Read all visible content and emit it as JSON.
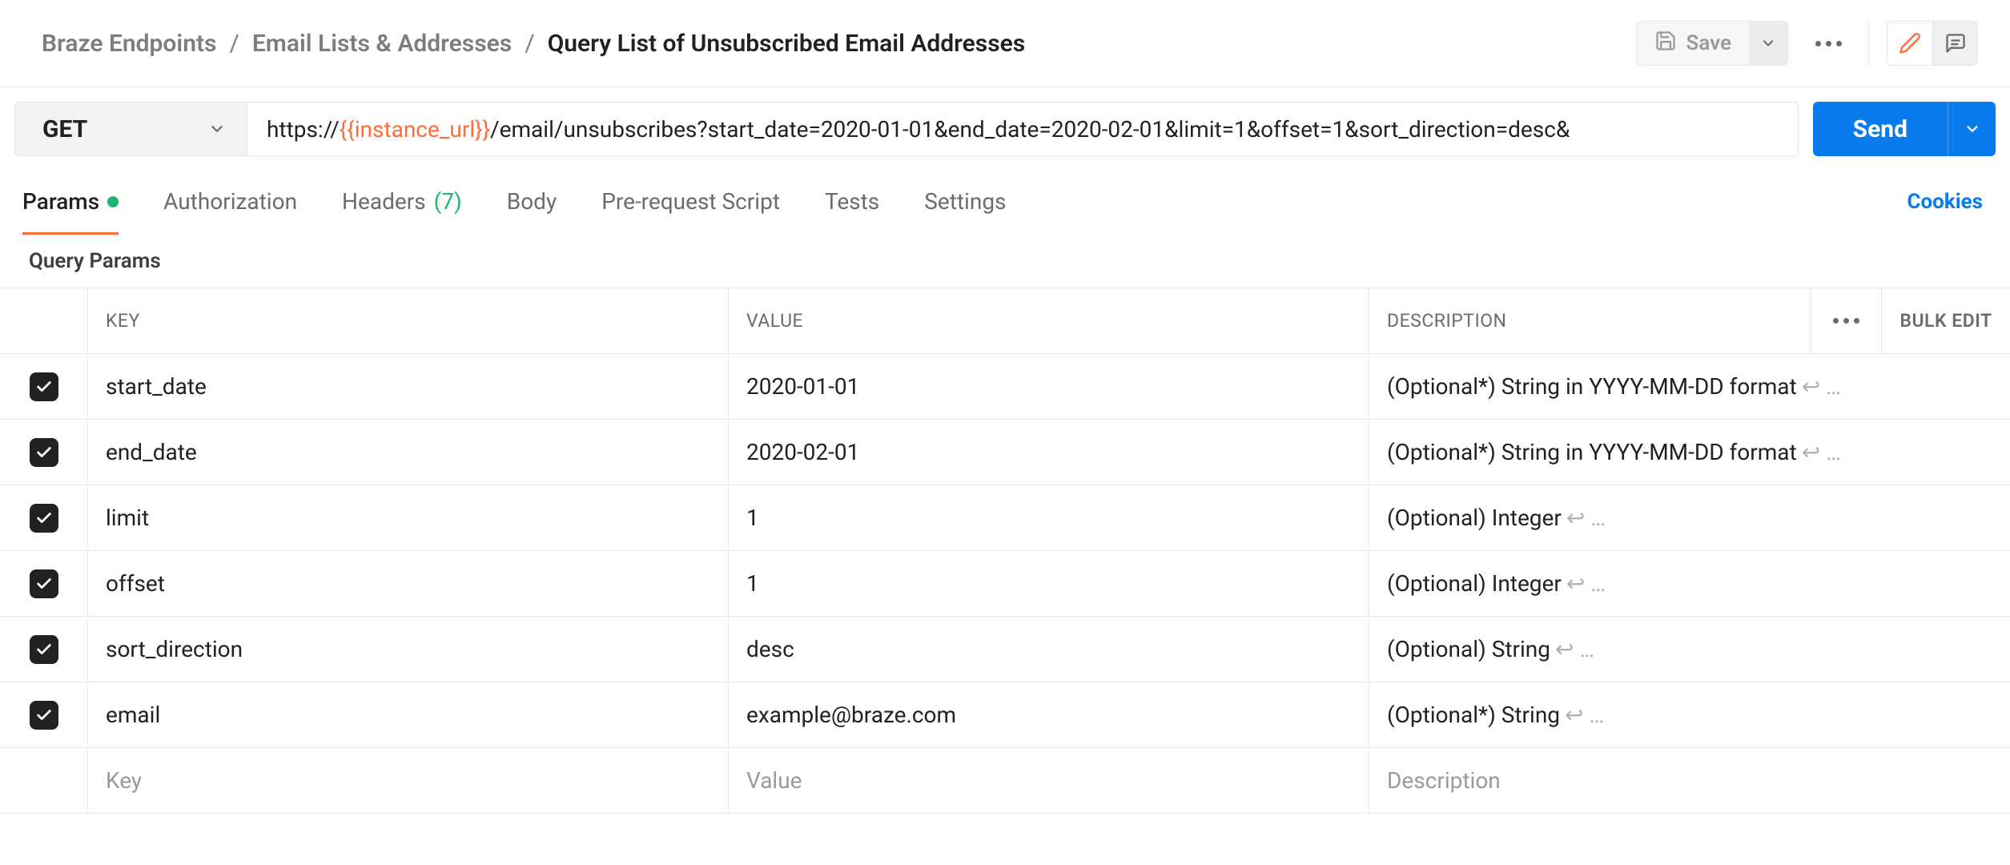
{
  "breadcrumb": {
    "root": "Braze Endpoints",
    "folder": "Email Lists & Addresses",
    "current": "Query List of Unsubscribed Email Addresses",
    "sep": "/"
  },
  "header": {
    "save_label": "Save"
  },
  "request": {
    "method": "GET",
    "url_prefix": "https://",
    "url_var": "{{instance_url}}",
    "url_suffix": "/email/unsubscribes?start_date=2020-01-01&end_date=2020-02-01&limit=1&offset=1&sort_direction=desc&",
    "send_label": "Send"
  },
  "tabs": {
    "params": "Params",
    "authorization": "Authorization",
    "headers": "Headers",
    "headers_count": "(7)",
    "body": "Body",
    "pre_request": "Pre-request Script",
    "tests": "Tests",
    "settings": "Settings",
    "cookies": "Cookies"
  },
  "section_title": "Query Params",
  "table": {
    "headers": {
      "key": "KEY",
      "value": "VALUE",
      "description": "DESCRIPTION",
      "bulk": "Bulk Edit"
    },
    "placeholders": {
      "key": "Key",
      "value": "Value",
      "description": "Description"
    },
    "desc_trailing": " ↩ …",
    "rows": [
      {
        "checked": true,
        "key": "start_date",
        "value": "2020-01-01",
        "description": "(Optional*) String in YYYY-MM-DD format"
      },
      {
        "checked": true,
        "key": "end_date",
        "value": "2020-02-01",
        "description": "(Optional*)  String in YYYY-MM-DD format"
      },
      {
        "checked": true,
        "key": "limit",
        "value": "1",
        "description": "(Optional) Integer"
      },
      {
        "checked": true,
        "key": "offset",
        "value": "1",
        "description": "(Optional) Integer"
      },
      {
        "checked": true,
        "key": "sort_direction",
        "value": "desc",
        "description": "(Optional) String"
      },
      {
        "checked": true,
        "key": "email",
        "value": "example@braze.com",
        "description": "(Optional*) String"
      }
    ]
  }
}
